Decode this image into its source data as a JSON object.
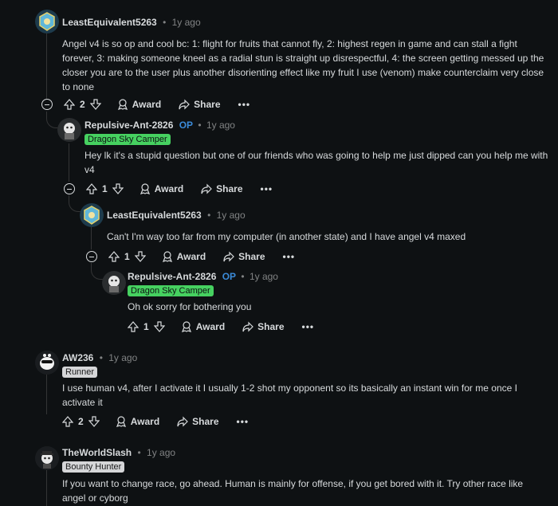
{
  "comments": [
    {
      "author": "LeastEquivalent5263",
      "separator": "•",
      "time": "1y ago",
      "body": "Angel v4 is so op and cool bc: 1: flight for fruits that cannot fly, 2: highest regen in game and can stall a fight forever, 3: making someone kneel as a radial stun is straight up disrespectful, 4: the screen getting messed up the closer you are to the user plus another disorienting effect like my fruit I use (venom) make counterclaim very close to none",
      "votes": "2",
      "award": "Award",
      "share": "Share",
      "more": "•••"
    },
    {
      "author": "Repulsive-Ant-2826",
      "op": "OP",
      "separator": "•",
      "time": "1y ago",
      "flair": "Dragon Sky Camper",
      "body": "Hey lk it's a stupid question but one of our friends who was going to help me just dipped can you help me with v4",
      "votes": "1",
      "award": "Award",
      "share": "Share",
      "more": "•••"
    },
    {
      "author": "LeastEquivalent5263",
      "separator": "•",
      "time": "1y ago",
      "body": "Can't I'm way too far from my computer (in another state) and I have angel v4 maxed",
      "votes": "1",
      "award": "Award",
      "share": "Share",
      "more": "•••"
    },
    {
      "author": "Repulsive-Ant-2826",
      "op": "OP",
      "separator": "•",
      "time": "1y ago",
      "flair": "Dragon Sky Camper",
      "body": "Oh ok sorry for bothering you",
      "votes": "1",
      "award": "Award",
      "share": "Share",
      "more": "•••"
    },
    {
      "author": "AW236",
      "separator": "•",
      "time": "1y ago",
      "flair": "Runner",
      "body": "I use human v4, after I activate it I usually 1-2 shot my opponent so its basically an instant win for me once I activate it",
      "votes": "2",
      "award": "Award",
      "share": "Share",
      "more": "•••"
    },
    {
      "author": "TheWorldSlash",
      "separator": "•",
      "time": "1y ago",
      "flair": "Bounty Hunter",
      "body": "If you want to change race, go ahead. Human is mainly for offense, if you get bored with it. Try other race like angel or cyborg"
    }
  ],
  "colors": {
    "background": "#0e1113",
    "text": "#d7dadc",
    "muted": "#818384",
    "op": "#3b8bd9",
    "flair_green": "#46d160",
    "flair_grey": "#d5d6d8"
  },
  "icons": [
    "upvote-icon",
    "downvote-icon",
    "award-icon",
    "share-icon",
    "collapse-icon",
    "more-icon"
  ]
}
